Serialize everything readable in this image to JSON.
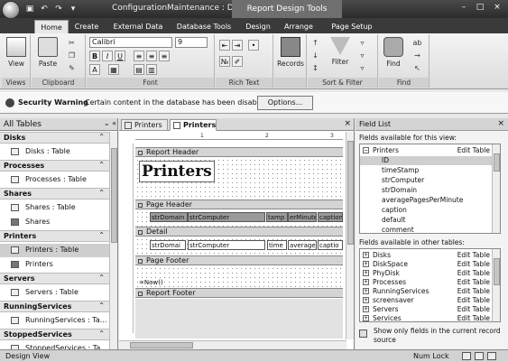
{
  "window": {
    "title": "ConfigurationMaintenance : Data...",
    "context_title": "Report Design Tools",
    "quick_access": [
      "save-icon",
      "undo-icon",
      "redo-icon",
      "dropdown-icon"
    ],
    "controls": {
      "minimize": "–",
      "maximize": "□",
      "close": "×"
    }
  },
  "ribbon": {
    "tabs": [
      "Home",
      "Create",
      "External Data",
      "Database Tools",
      "Design",
      "Arrange",
      "Page Setup"
    ],
    "active_tab": "Home",
    "groups": {
      "views": {
        "label": "Views",
        "view_button": "View"
      },
      "clipboard": {
        "label": "Clipboard",
        "paste_button": "Paste"
      },
      "font": {
        "label": "Font",
        "font_name": "Calibri",
        "font_size": "9",
        "bold": "B",
        "italic": "I",
        "underline": "U",
        "font_color": "A"
      },
      "rich_text": {
        "label": "Rich Text"
      },
      "records": {
        "label": "",
        "records_button": "Records"
      },
      "sort_filter": {
        "label": "Sort & Filter",
        "filter_button": "Filter"
      },
      "find": {
        "label": "Find",
        "find_button": "Find"
      }
    }
  },
  "security_bar": {
    "title": "Security Warning",
    "message": "Certain content in the database has been disabled",
    "options_button": "Options..."
  },
  "nav_pane": {
    "title": "All Tables",
    "sections": [
      {
        "name": "Disks",
        "items": [
          {
            "label": "Disks : Table",
            "type": "table",
            "selected": false
          }
        ]
      },
      {
        "name": "Processes",
        "items": [
          {
            "label": "Processes : Table",
            "type": "table",
            "selected": false
          }
        ]
      },
      {
        "name": "Shares",
        "items": [
          {
            "label": "Shares : Table",
            "type": "table",
            "selected": false
          },
          {
            "label": "Shares",
            "type": "report",
            "selected": false
          }
        ]
      },
      {
        "name": "Printers",
        "items": [
          {
            "label": "Printers : Table",
            "type": "table",
            "selected": true
          },
          {
            "label": "Printers",
            "type": "report",
            "selected": false
          }
        ]
      },
      {
        "name": "Servers",
        "items": [
          {
            "label": "Servers : Table",
            "type": "table",
            "selected": false
          }
        ]
      },
      {
        "name": "RunningServices",
        "items": [
          {
            "label": "RunningServices : Ta...",
            "type": "table",
            "selected": false
          }
        ]
      },
      {
        "name": "StoppedServices",
        "items": [
          {
            "label": "StoppedServices : Ta...",
            "type": "table",
            "selected": false
          }
        ]
      }
    ]
  },
  "document": {
    "tabs": [
      {
        "label": "Printers",
        "active": false
      },
      {
        "label": "Printers",
        "active": true
      }
    ],
    "ruler_marks": [
      "1",
      "2",
      "3"
    ],
    "bands": {
      "report_header": "Report Header",
      "page_header": "Page Header",
      "detail": "Detail",
      "page_footer": "Page Footer",
      "report_footer": "Report Footer"
    },
    "report_title": "Printers",
    "header_labels": [
      "strDomain",
      "strComputer",
      "tamp",
      "erMinute",
      "caption"
    ],
    "detail_fields": [
      "strDomai",
      "strComputer",
      "time",
      "average",
      "captio"
    ],
    "new_label": "=Now()"
  },
  "field_list": {
    "title": "Field List",
    "available_caption": "Fields available for this view:",
    "current_table": {
      "name": "Printers",
      "edit": "Edit Table"
    },
    "fields": [
      "ID",
      "timeStamp",
      "strComputer",
      "strDomain",
      "averagePagesPerMinute",
      "caption",
      "default",
      "comment"
    ],
    "selected_field": "ID",
    "other_caption": "Fields available in other tables:",
    "other_tables": [
      {
        "name": "Disks",
        "edit": "Edit Table"
      },
      {
        "name": "DiskSpace",
        "edit": "Edit Table"
      },
      {
        "name": "PhyDisk",
        "edit": "Edit Table"
      },
      {
        "name": "Processes",
        "edit": "Edit Table"
      },
      {
        "name": "RunningServices",
        "edit": "Edit Table"
      },
      {
        "name": "screensaver",
        "edit": "Edit Table"
      },
      {
        "name": "Servers",
        "edit": "Edit Table"
      },
      {
        "name": "Services",
        "edit": "Edit Table"
      }
    ],
    "footer_text": "Show only fields in the current record source"
  },
  "status_bar": {
    "left": "Design View",
    "num_lock": "Num Lock"
  }
}
